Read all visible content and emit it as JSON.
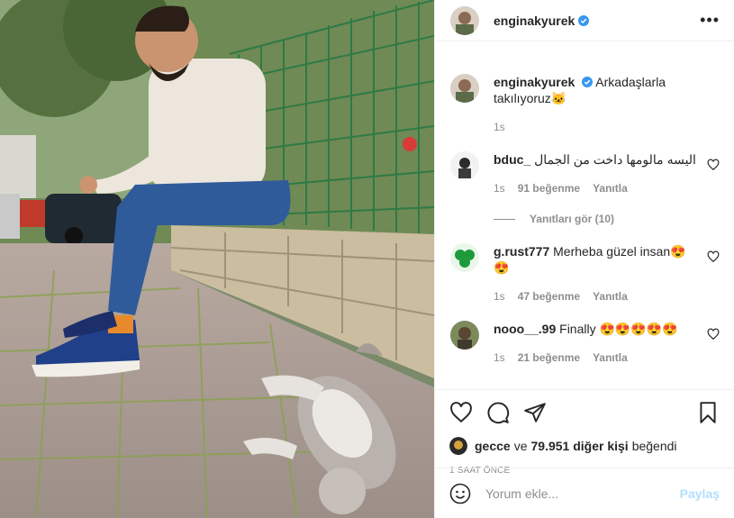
{
  "post": {
    "author": "enginakyurek",
    "more_icon": "more-horizontal-icon"
  },
  "caption": {
    "author": "enginakyurek",
    "text": "Arkadaşlarla takılıyoruz🐱",
    "time": "1s"
  },
  "comments": [
    {
      "user": "bduc_",
      "text": "اليسه مالومها داخت من الجمال",
      "time": "1s",
      "likes": "91 beğenme",
      "reply": "Yanıtla",
      "replies": "Yanıtları gör (10)"
    },
    {
      "user": "g.rust777",
      "text": "Merheba güzel insan😍😍",
      "time": "1s",
      "likes": "47 beğenme",
      "reply": "Yanıtla"
    },
    {
      "user": "nooo__.99",
      "text": "Finally 😍😍😍😍😍",
      "time": "1s",
      "likes": "21 beğenme",
      "reply": "Yanıtla"
    }
  ],
  "likes": {
    "user": "gecce",
    "connector": "ve",
    "count": "79.951 diğer kişi",
    "suffix": "beğendi"
  },
  "timestamp": "1 SAAT ÖNCE",
  "add_comment": {
    "placeholder": "Yorum ekle...",
    "post_label": "Paylaş"
  },
  "colors": {
    "verified": "#3897f0",
    "post_disabled": "#b2dffc",
    "muted": "#8e8e8e"
  }
}
